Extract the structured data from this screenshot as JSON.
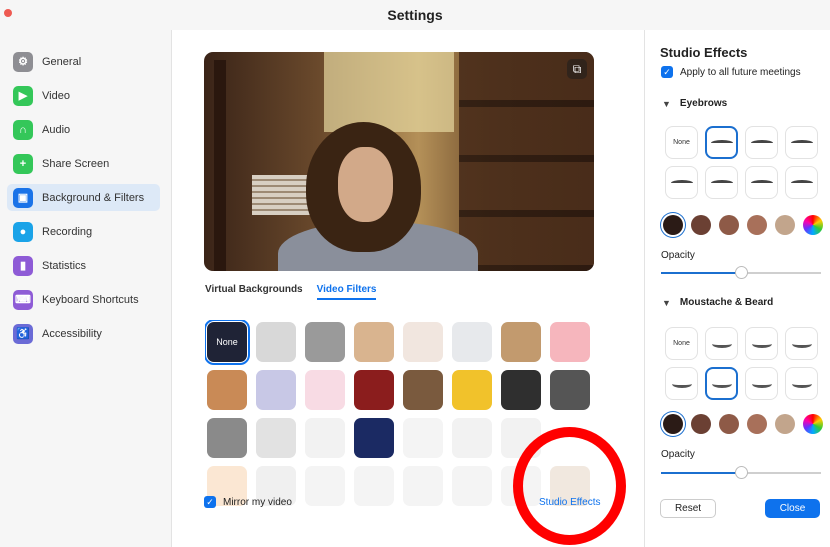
{
  "window": {
    "title": "Settings"
  },
  "sidebar": {
    "items": [
      {
        "label": "General",
        "icon": "gear-icon",
        "color": "#8e8e93"
      },
      {
        "label": "Video",
        "icon": "video-camera-icon",
        "color": "#34c759"
      },
      {
        "label": "Audio",
        "icon": "headphones-icon",
        "color": "#34c759"
      },
      {
        "label": "Share Screen",
        "icon": "share-screen-icon",
        "color": "#34c759"
      },
      {
        "label": "Background & Filters",
        "icon": "background-icon",
        "color": "#1a73e8",
        "active": true
      },
      {
        "label": "Recording",
        "icon": "record-icon",
        "color": "#1aa3e8"
      },
      {
        "label": "Statistics",
        "icon": "statistics-icon",
        "color": "#8e5bd6"
      },
      {
        "label": "Keyboard Shortcuts",
        "icon": "keyboard-icon",
        "color": "#8e5bd6"
      },
      {
        "label": "Accessibility",
        "icon": "accessibility-icon",
        "color": "#6b6bd6"
      }
    ]
  },
  "main": {
    "tabs": [
      {
        "label": "Virtual Backgrounds",
        "active": false
      },
      {
        "label": "Video Filters",
        "active": true
      }
    ],
    "filters": [
      {
        "label": "None",
        "icon": "none-filter",
        "color": "#1f2336",
        "selected": true
      },
      {
        "icon": "filter-bw-light",
        "color": "#d8d8d8"
      },
      {
        "icon": "filter-gray",
        "color": "#9a9a9a"
      },
      {
        "icon": "filter-warm",
        "color": "#d9b48f"
      },
      {
        "icon": "filter-light",
        "color": "#f1e6df"
      },
      {
        "icon": "filter-cool",
        "color": "#e7e9ec"
      },
      {
        "icon": "filter-sepia",
        "color": "#c29a6e"
      },
      {
        "icon": "filter-pink",
        "color": "#f6b6bd"
      },
      {
        "icon": "filter-bear",
        "color": "#c98a56"
      },
      {
        "icon": "filter-tv-frame",
        "color": "#c8c8e6"
      },
      {
        "icon": "filter-love",
        "color": "#f8dbe4"
      },
      {
        "icon": "filter-theater",
        "color": "#8b1d1d"
      },
      {
        "icon": "filter-retro-tv",
        "color": "#7a5a3e"
      },
      {
        "icon": "filter-sunflowers",
        "color": "#f1c22b"
      },
      {
        "icon": "filter-film-strip",
        "color": "#2f2f2f"
      },
      {
        "icon": "filter-camera-frame",
        "color": "#555555"
      },
      {
        "icon": "filter-old-tv",
        "color": "#8a8a8a"
      },
      {
        "icon": "filter-ribbon-award",
        "color": "#e2e2e2"
      },
      {
        "icon": "filter-speech-bubble",
        "color": "#f2f2f2"
      },
      {
        "icon": "filter-string-lights",
        "color": "#1b2a63"
      },
      {
        "icon": "filter-heart-sticker",
        "color": "#f4f4f4"
      },
      {
        "icon": "filter-sunglasses",
        "color": "#f2f2f2"
      },
      {
        "icon": "filter-sprout",
        "color": "#f2f2f2"
      },
      {
        "icon": "filter-empty",
        "color": "#ffffff"
      },
      {
        "icon": "filter-pizza",
        "color": "#fbe7d3"
      },
      {
        "icon": "filter-ninja",
        "color": "#f0f0f0"
      },
      {
        "icon": "filter-blank",
        "color": "#f4f4f4"
      },
      {
        "icon": "filter-face-1",
        "color": "#f4f4f4"
      },
      {
        "icon": "filter-face-2",
        "color": "#f4f4f4"
      },
      {
        "icon": "filter-dog",
        "color": "#f4f4f4"
      },
      {
        "icon": "filter-face-3",
        "color": "#f4f4f4"
      },
      {
        "icon": "filter-reindeer",
        "color": "#f1e8df"
      }
    ],
    "mirror": {
      "label": "Mirror my video",
      "checked": true
    },
    "studio_effects_link": "Studio Effects"
  },
  "panel": {
    "title": "Studio Effects",
    "apply_label": "Apply to all future meetings",
    "eyebrows": {
      "title": "Eyebrows",
      "none_label": "None",
      "selected_index": 1,
      "colors": [
        "#2b1b16",
        "#6b4033",
        "#8e5a47",
        "#a8705a",
        "#c2a58c"
      ],
      "opacity_label": "Opacity",
      "opacity": 0.5
    },
    "mustache": {
      "title": "Moustache & Beard",
      "none_label": "None",
      "selected_index": 5,
      "colors": [
        "#2b1b16",
        "#6b4033",
        "#8e5a47",
        "#a8705a",
        "#c2a58c"
      ],
      "opacity_label": "Opacity",
      "opacity": 0.5
    },
    "reset_label": "Reset",
    "close_label": "Close"
  },
  "colors": {
    "accent": "#0e72ed",
    "annotation": "#ff0000"
  }
}
